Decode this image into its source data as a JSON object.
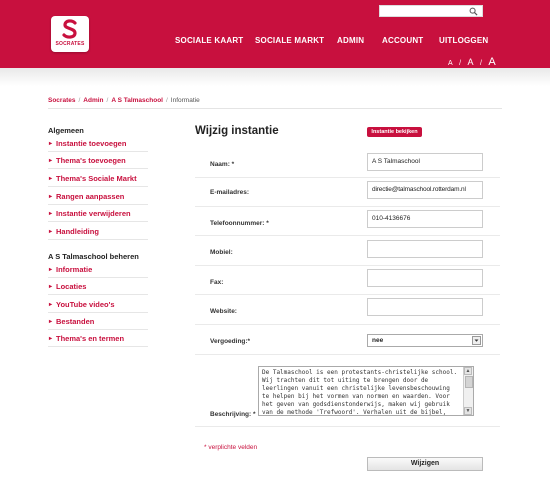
{
  "brand": {
    "logo_text": "SOCRATES",
    "accent": "#c8103e"
  },
  "header": {
    "search": {
      "placeholder": "",
      "icon": "search-icon"
    },
    "nav": [
      {
        "label": "SOCIALE KAART"
      },
      {
        "label": "SOCIALE MARKT"
      },
      {
        "label": "ADMIN"
      },
      {
        "label": "ACCOUNT"
      },
      {
        "label": "UITLOGGEN"
      }
    ],
    "font_size": {
      "small": "A",
      "sep1": "/",
      "medium": "A",
      "sep2": "/",
      "large": "A"
    }
  },
  "breadcrumb": {
    "items": [
      "Socrates",
      "Admin",
      "A S Talmaschool"
    ],
    "separator": "/",
    "current": "Informatie"
  },
  "sidebar": {
    "general": {
      "title": "Algemeen",
      "items": [
        {
          "label": "Instantie toevoegen"
        },
        {
          "label": "Thema's toevoegen"
        },
        {
          "label": "Thema's Sociale Markt"
        },
        {
          "label": "Rangen aanpassen"
        },
        {
          "label": "Instantie verwijderen"
        },
        {
          "label": "Handleiding"
        }
      ]
    },
    "manage": {
      "title": "A S Talmaschool beheren",
      "items": [
        {
          "label": "Informatie"
        },
        {
          "label": "Locaties"
        },
        {
          "label": "YouTube video's"
        },
        {
          "label": "Bestanden"
        },
        {
          "label": "Thema's en termen"
        }
      ]
    },
    "bullet": "▸"
  },
  "form": {
    "title": "Wijzig instantie",
    "view_button": "Instantie bekijken",
    "fields": {
      "name": {
        "label": "Naam: *",
        "value": "A S Talmaschool"
      },
      "email": {
        "label": "E-mailadres:",
        "value": "directie@talmaschool.rotterdam.nl"
      },
      "phone": {
        "label": "Telefoonnummer: *",
        "value": "010-4136676"
      },
      "mobile": {
        "label": "Mobiel:",
        "value": ""
      },
      "fax": {
        "label": "Fax:",
        "value": ""
      },
      "website": {
        "label": "Website:",
        "value": ""
      },
      "compensation": {
        "label": "Vergoeding:*",
        "value": "nee"
      },
      "description": {
        "label": "Beschrijving: *",
        "value": "De Talmaschool is een protestants-christelijke school. Wij trachten dit tot uiting te brengen door de leerlingen vanuit een christelijke levensbeschouwing te helpen bij het vormen van normen en waarden. Voor het geven van godsdienstonderwijs, maken wij gebruik van de methode 'Trefwoord'. Verhalen uit de bijbel, maar"
      }
    },
    "required_note": "* verplichte velden",
    "submit_label": "Wijzigen"
  }
}
